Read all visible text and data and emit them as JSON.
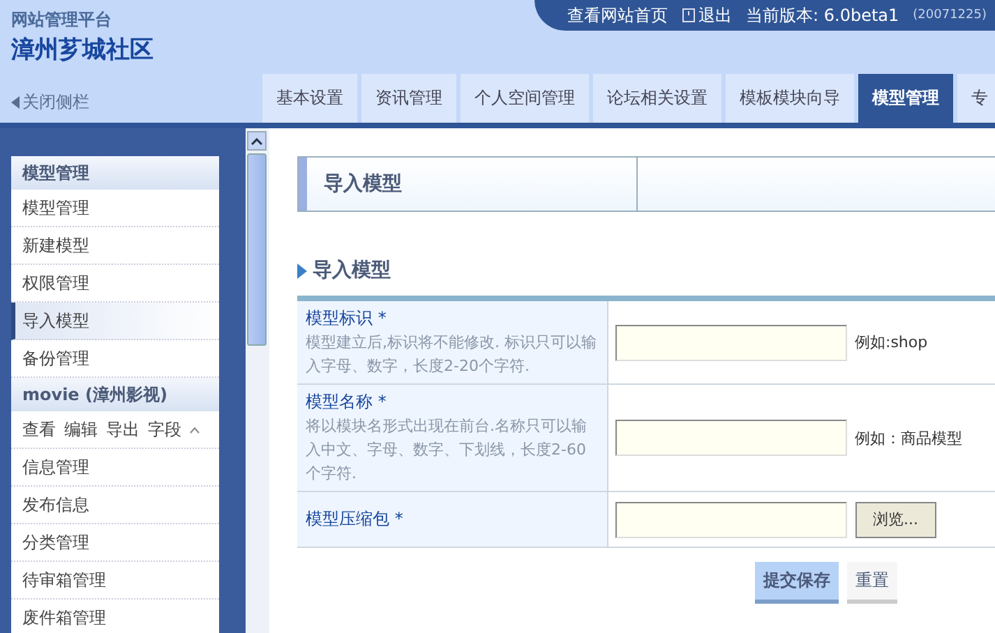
{
  "header": {
    "platform": "网站管理平台",
    "site_name": "漳州芗城社区",
    "links": [
      {
        "label": "查看网站首页",
        "kind": "plain"
      },
      {
        "label": "退出",
        "kind": "logout"
      }
    ],
    "version": "当前版本: 6.0beta1",
    "build": "(20071225)",
    "sidebar_toggle": "关闭侧栏"
  },
  "tabs": [
    {
      "label": "基本设置",
      "selected": false
    },
    {
      "label": "资讯管理",
      "selected": false
    },
    {
      "label": "个人空间管理",
      "selected": false
    },
    {
      "label": "论坛相关设置",
      "selected": false
    },
    {
      "label": "模板模块向导",
      "selected": false
    },
    {
      "label": "模型管理",
      "selected": true
    },
    {
      "label": "专",
      "selected": false
    }
  ],
  "sidebar": {
    "sections": [
      {
        "title": "模型管理",
        "items": [
          {
            "label": "模型管理",
            "selected": false
          },
          {
            "label": "新建模型",
            "selected": false
          },
          {
            "label": "权限管理",
            "selected": false
          },
          {
            "label": "导入模型",
            "selected": true
          },
          {
            "label": "备份管理",
            "selected": false
          }
        ]
      },
      {
        "title": "movie (漳州影视)",
        "actions": [
          "查看",
          "编辑",
          "导出",
          "字段"
        ],
        "items": [
          {
            "label": "信息管理",
            "selected": false
          },
          {
            "label": "发布信息",
            "selected": false
          },
          {
            "label": "分类管理",
            "selected": false
          },
          {
            "label": "待审箱管理",
            "selected": false
          },
          {
            "label": "废件箱管理",
            "selected": false
          }
        ]
      }
    ]
  },
  "page_title": "导入模型",
  "section_title": "导入模型",
  "form": [
    {
      "kind": "text",
      "label": "模型标识",
      "required": "*",
      "hint": "模型建立后,标识将不能修改. 标识只可以输入字母、数字，长度2-20个字符.",
      "example": "例如:shop"
    },
    {
      "kind": "text",
      "label": "模型名称",
      "required": "*",
      "hint": "将以模块名形式出现在前台.名称只可以输入中文、字母、数字、下划线，长度2-60个字符.",
      "example": "例如：商品模型"
    },
    {
      "kind": "file",
      "label": "模型压缩包",
      "required": "*",
      "button": "浏览..."
    }
  ],
  "buttons": [
    {
      "label": "提交保存",
      "kind": "primary"
    },
    {
      "label": "重置",
      "kind": "secondary"
    }
  ]
}
